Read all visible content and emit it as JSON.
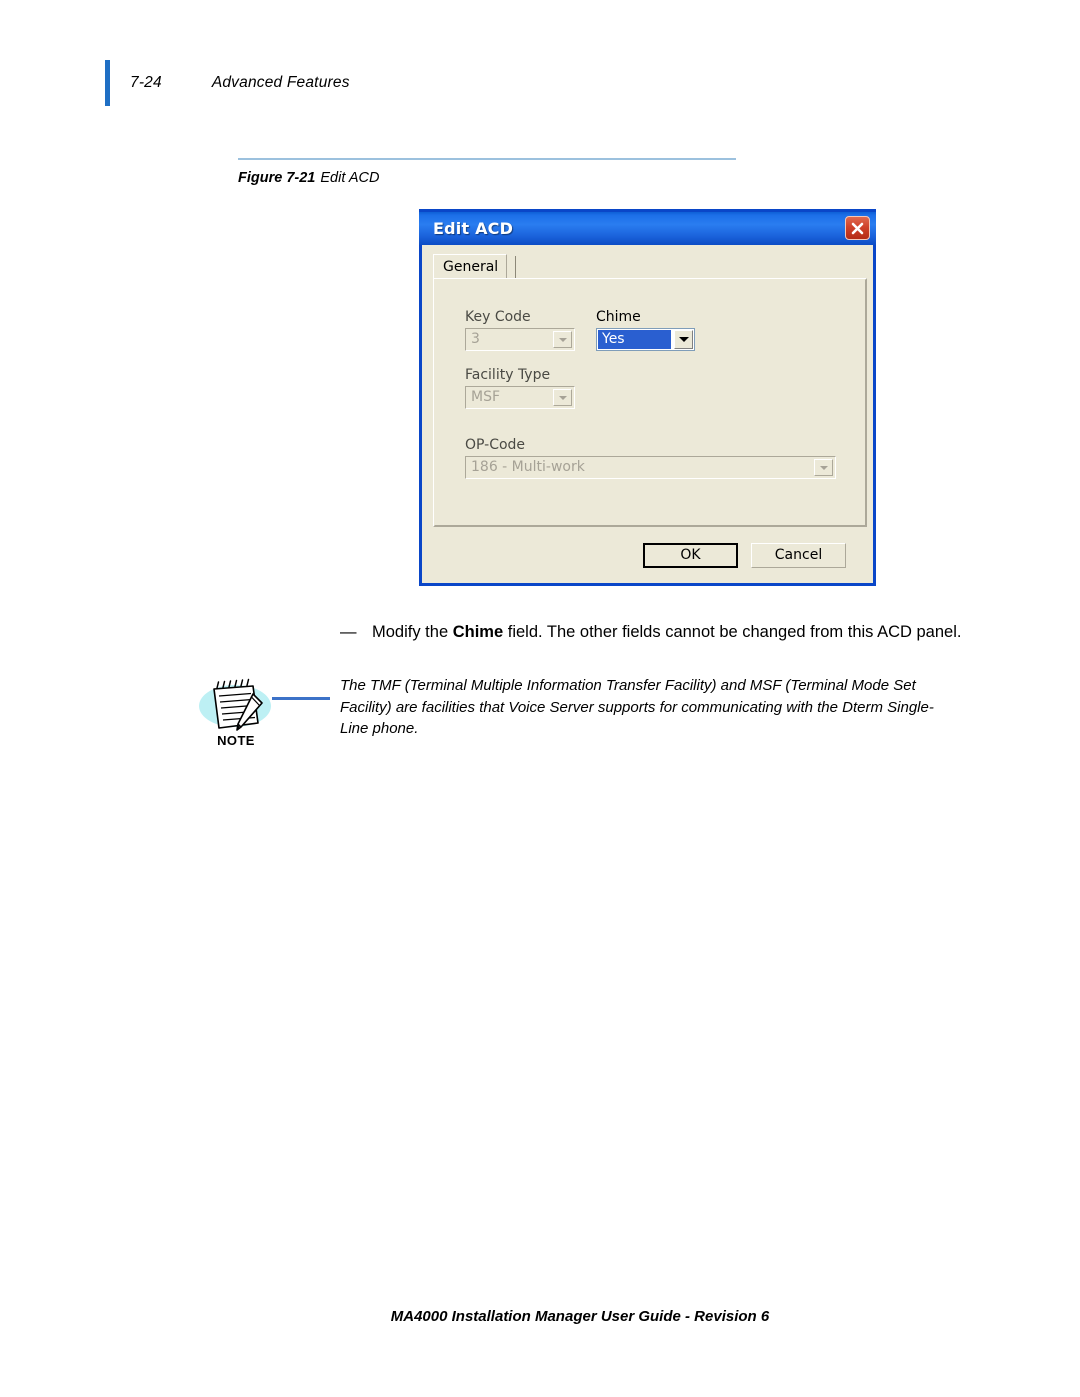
{
  "header": {
    "page_number": "7-24",
    "section_title": "Advanced Features"
  },
  "figure": {
    "label": "Figure 7-21",
    "title": "Edit ACD"
  },
  "dialog": {
    "title": "Edit ACD",
    "close_icon": "close-icon",
    "tabs": [
      {
        "label": "General",
        "selected": true
      }
    ],
    "fields": [
      {
        "label": "Key Code",
        "value": "3",
        "enabled": false,
        "control": "combobox"
      },
      {
        "label": "Chime",
        "value": "Yes",
        "enabled": true,
        "control": "combobox"
      },
      {
        "label": "Facility Type",
        "value": "MSF",
        "enabled": false,
        "control": "combobox"
      },
      {
        "label": "OP-Code",
        "value": "186 - Multi-work",
        "enabled": false,
        "control": "combobox"
      }
    ],
    "buttons": {
      "ok": "OK",
      "cancel": "Cancel"
    },
    "colors": {
      "titlebar_blue": "#1C6FE8",
      "dialog_border": "#0A46C8",
      "face": "#ECE9D8",
      "selection_blue": "#2A5FD0",
      "close_red": "#D0422A"
    }
  },
  "body": {
    "bullet_dash": "—",
    "paragraph_pre": "Modify the ",
    "paragraph_bold": "Chime",
    "paragraph_post": " field. The other fields cannot be changed from this ACD panel."
  },
  "note": {
    "label": "NOTE",
    "icon": "note-pad-pencil-icon",
    "text": "The TMF (Terminal Multiple Information Transfer Facility) and MSF (Terminal Mode Set Facility) are facilities that Voice Server supports for communicating with the Dterm Single-Line phone.",
    "connector_color": "#3C72C8"
  },
  "footer": {
    "text": "MA4000 Installation Manager User Guide - Revision 6"
  }
}
